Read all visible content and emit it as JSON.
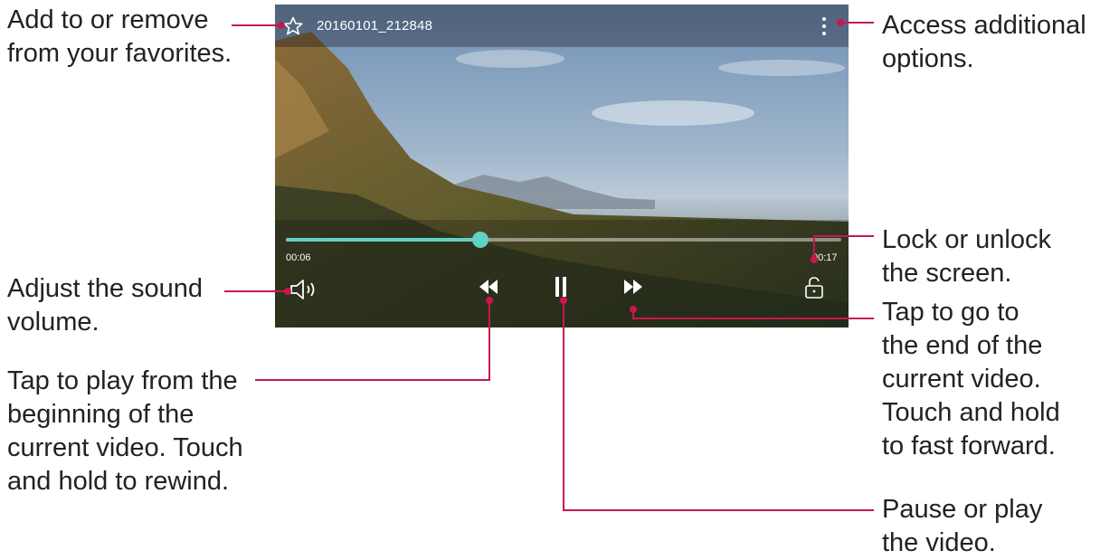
{
  "player": {
    "file_name": "20160101_212848",
    "current_time": "00:06",
    "total_time": "00:17",
    "progress": 0.35,
    "accent_color": "#5fd3c3",
    "icons": [
      "star-outline-icon",
      "more-vert-icon",
      "volume-icon",
      "rewind-icon",
      "pause-icon",
      "fast-forward-icon",
      "unlock-icon"
    ]
  },
  "annotations": {
    "favorites": [
      "Add to or remove",
      "from your favorites."
    ],
    "options": [
      "Access additional",
      "options."
    ],
    "lock": [
      "Lock or unlock",
      "the screen."
    ],
    "volume": [
      "Adjust the sound",
      "volume."
    ],
    "forward": [
      "Tap to go to",
      "the end of the",
      "current video.",
      "Touch and hold",
      "to fast forward."
    ],
    "rewind": [
      "Tap to play from the",
      "beginning of the",
      "current video. Touch",
      "and hold to rewind."
    ],
    "pause": [
      "Pause or play",
      "the video."
    ],
    "leader_color": "#c8174e"
  }
}
